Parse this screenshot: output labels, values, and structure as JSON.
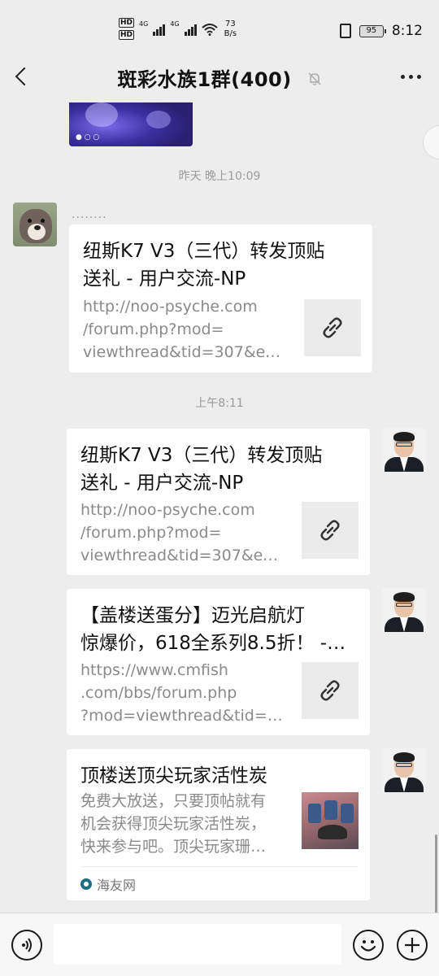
{
  "status_bar": {
    "hd1": "HD",
    "hd2": "HD",
    "net1": "4G",
    "net2": "4G",
    "speed_value": "73",
    "speed_unit": "B/s",
    "battery": "95",
    "time": "8:12"
  },
  "header": {
    "title": "斑彩水族1群(400)"
  },
  "chat": {
    "top_image_dots": "● ○ ○",
    "timestamp_1": "昨天 晚上10:09",
    "timestamp_2": "上午8:11",
    "messages": [
      {
        "sender": "........",
        "title_lines": [
          "纽斯K7 V3（三代）转发顶贴",
          "送礼 - 用户交流-NP"
        ],
        "desc_lines": [
          "http://noo-psyche.com",
          "/forum.php?mod=",
          "viewthread&tid=307&extr…"
        ],
        "thumb": "link-icon"
      },
      {
        "title_lines": [
          "纽斯K7 V3（三代）转发顶贴",
          "送礼 - 用户交流-NP"
        ],
        "desc_lines": [
          "http://noo-psyche.com",
          "/forum.php?mod=",
          "viewthread&tid=307&extr…"
        ],
        "thumb": "link-icon"
      },
      {
        "title_lines": [
          "【盖楼送蛋分】迈光启航灯",
          "惊爆价，618全系列8.5折！ -…"
        ],
        "desc_lines": [
          "https://www.cmfish",
          ".com/bbs/forum.php",
          "?mod=viewthread&tid=81…"
        ],
        "thumb": "link-icon"
      },
      {
        "title_lines": [
          "顶楼送顶尖玩家活性炭"
        ],
        "desc_lines": [
          "免费大放送，只要顶帖就有",
          "机会获得顶尖玩家活性炭，",
          "快来参与吧。顶尖玩家珊…"
        ],
        "thumb": "product-photo",
        "source": "海友网"
      }
    ]
  },
  "colors": {
    "background": "#ededed",
    "card": "#ffffff",
    "muted_text": "#8a8a8a"
  }
}
